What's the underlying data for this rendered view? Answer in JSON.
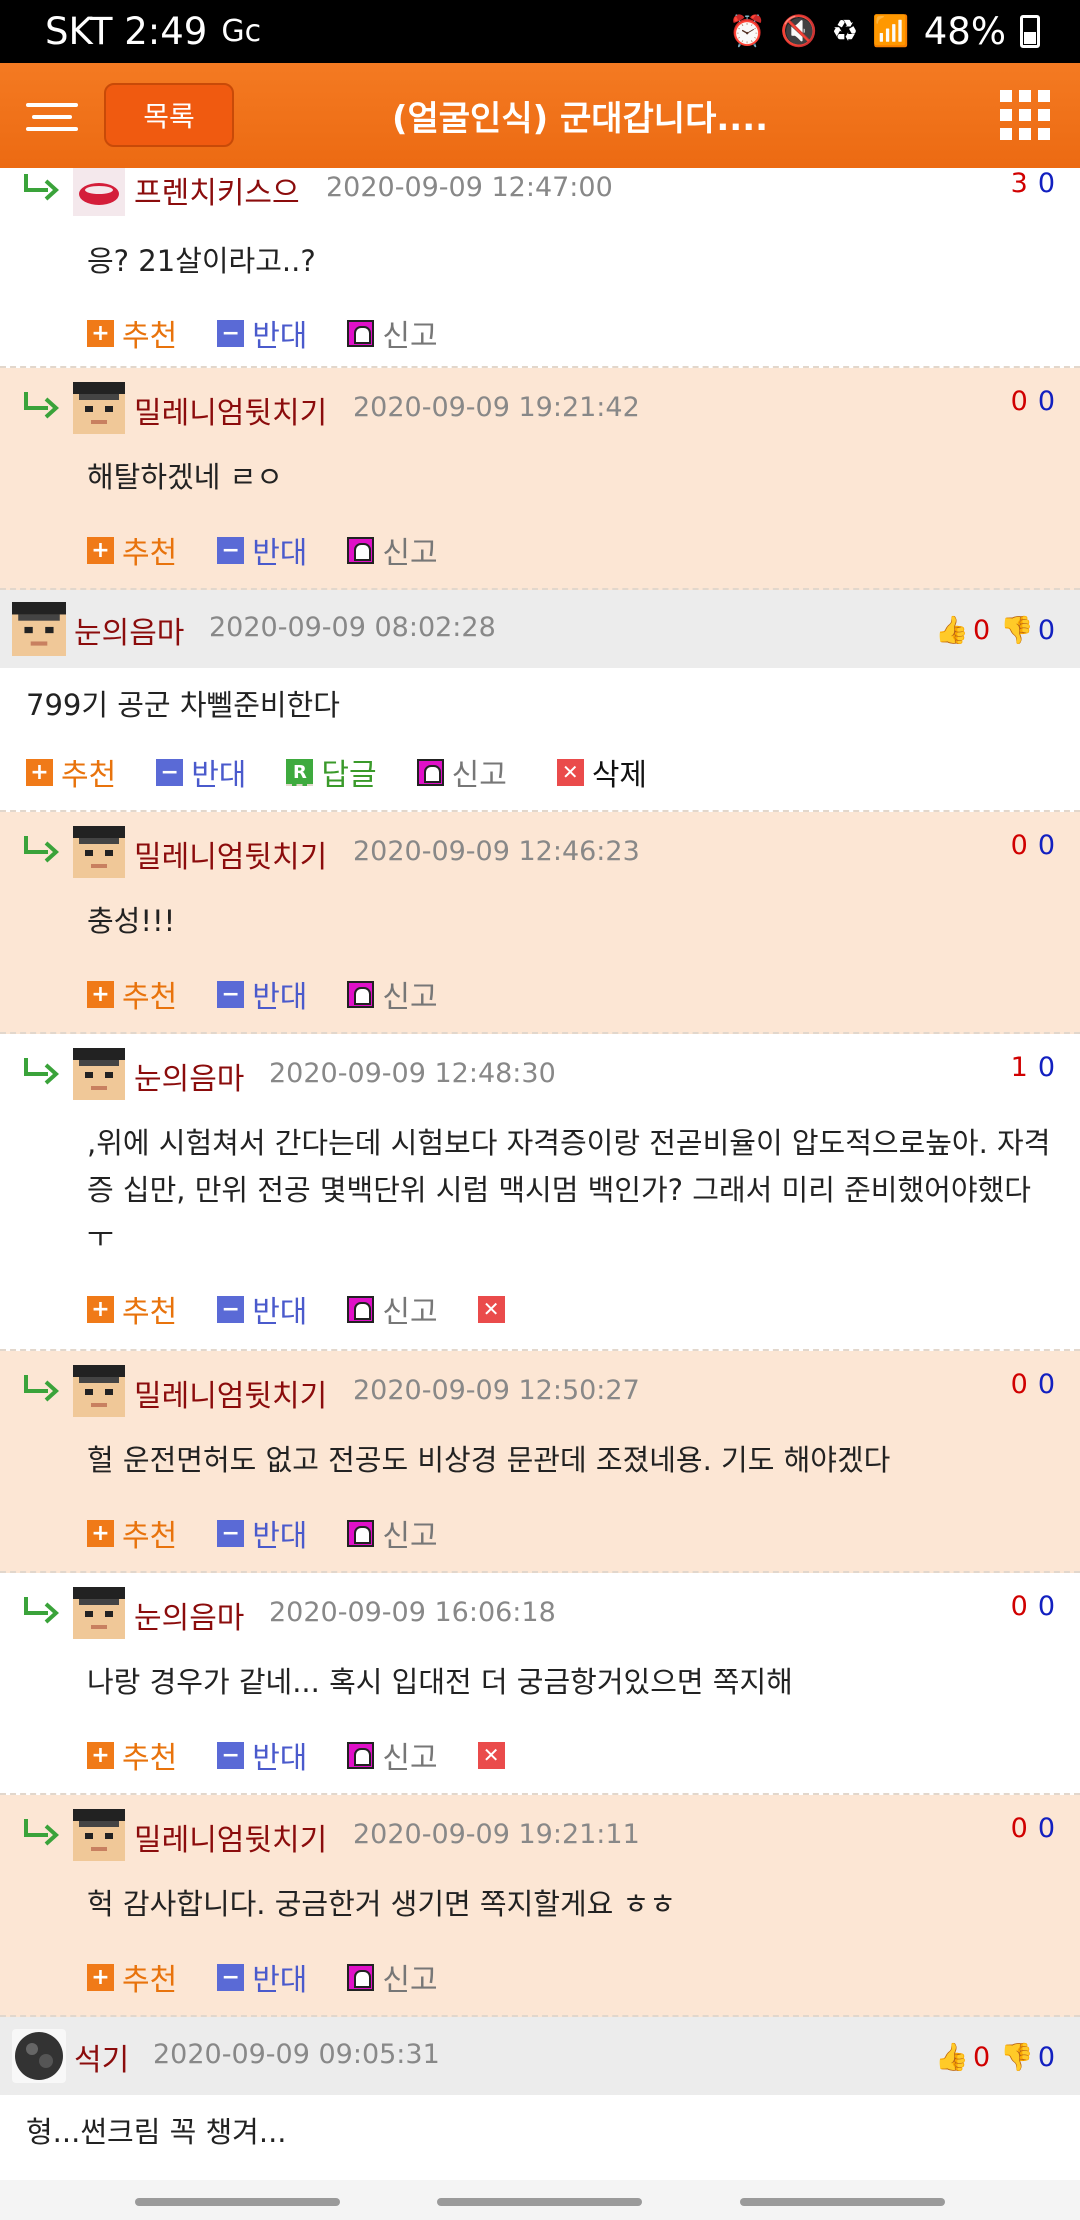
{
  "status": {
    "carrier_time": "SKT 2:49",
    "battery": "48%"
  },
  "header": {
    "list_button": "목록",
    "title": "(얼굴인식) 군대갑니다...."
  },
  "actions": {
    "up": "추천",
    "down": "반대",
    "reply": "답글",
    "report": "신고",
    "delete": "삭제"
  },
  "replies_a": [
    {
      "nick": "프렌치키스으",
      "date": "2020-09-09 12:47:00",
      "up": "3",
      "down": "0",
      "text": "응? 21살이라고..?"
    },
    {
      "nick": "밀레니엄뒷치기",
      "date": "2020-09-09 19:21:42",
      "up": "0",
      "down": "0",
      "text": "해탈하겠네 ㄹㅇ"
    }
  ],
  "comment1": {
    "nick": "눈의음마",
    "date": "2020-09-09 08:02:28",
    "up": "0",
    "down": "0",
    "text": "799기 공군 차뻴준비한다"
  },
  "replies_b": [
    {
      "nick": "밀레니엄뒷치기",
      "date": "2020-09-09 12:46:23",
      "up": "0",
      "down": "0",
      "text": "충성!!!"
    },
    {
      "nick": "눈의음마",
      "date": "2020-09-09 12:48:30",
      "up": "1",
      "down": "0",
      "text": ",위에 시험쳐서 간다는데 시험보다 자격증이랑 전곧비율이 압도적으로높아. 자격증 십만, 만위 전공 몇백단위 시럼 맥시멈 백인가? 그래서 미리 준비했어야했다 ㅜ"
    },
    {
      "nick": "밀레니엄뒷치기",
      "date": "2020-09-09 12:50:27",
      "up": "0",
      "down": "0",
      "text": "헐 운전면허도 없고 전공도 비상경 문관데 조졌네용. 기도 해야겠다"
    },
    {
      "nick": "눈의음마",
      "date": "2020-09-09 16:06:18",
      "up": "0",
      "down": "0",
      "text": "나랑 경우가 같네... 혹시 입대전 더 궁금항거있으면 쪽지해"
    },
    {
      "nick": "밀레니엄뒷치기",
      "date": "2020-09-09 19:21:11",
      "up": "0",
      "down": "0",
      "text": "헉 감사합니다. 궁금한거 생기면 쪽지할게요 ㅎㅎ"
    }
  ],
  "comment2": {
    "nick": "석기",
    "date": "2020-09-09 09:05:31",
    "up": "0",
    "down": "0",
    "text": "형...썬크림 꼭 챙겨..."
  }
}
